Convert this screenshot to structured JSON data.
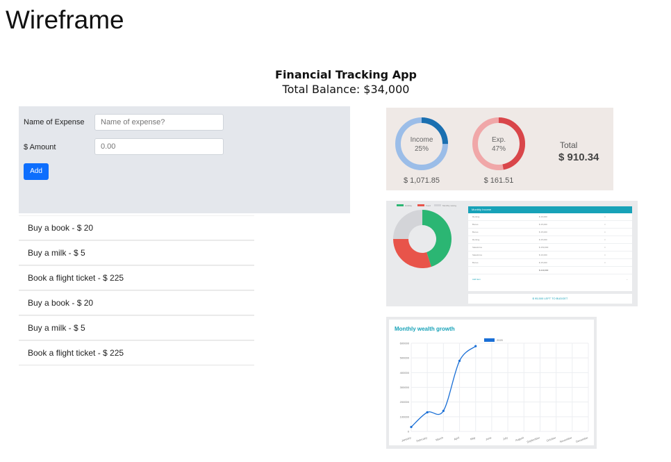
{
  "wireframe_title": "Wireframe",
  "app": {
    "title": "Financial Tracking App",
    "balance": "Total Balance: $34,000"
  },
  "form": {
    "name_label": "Name of Expense",
    "name_placeholder": "Name of expense?",
    "amount_label": "$ Amount",
    "amount_placeholder": "0.00",
    "add_label": "Add"
  },
  "expenses": [
    "Buy a book - $ 20",
    "Buy a milk - $ 5",
    "Book a flight ticket - $ 225",
    "Buy a book - $ 20",
    "Buy a milk - $ 5",
    "Book a flight ticket - $ 225"
  ],
  "summary": {
    "income_label": "Income",
    "income_pct": "25%",
    "income_amount": "$ 1,071.85",
    "income_fraction": 0.25,
    "exp_label": "Exp.",
    "exp_pct": "47%",
    "exp_amount": "$ 161.51",
    "exp_fraction": 0.47,
    "total_label": "Total",
    "total_value": "$ 910.34",
    "colors": {
      "income": "#1a6fb0",
      "income_track": "#9bbde8",
      "exp": "#d9464a",
      "exp_track": "#f0a7a8"
    }
  },
  "monthly_income": {
    "legend": [
      "Holiday",
      "Food",
      "Monthly saving"
    ],
    "title": "Monthly Income",
    "rows": [
      {
        "name": "Renting",
        "value": "$ 10,000"
      },
      {
        "name": "Bonus",
        "value": "$ 15,000"
      },
      {
        "name": "Bonus",
        "value": "$ 15,000"
      },
      {
        "name": "Renting",
        "value": "$ 15,000"
      },
      {
        "name": "Salesforce",
        "value": "$ 150,000"
      },
      {
        "name": "Salesforce",
        "value": "$ 10,000"
      },
      {
        "name": "Bonus",
        "value": "$ 15,000"
      }
    ],
    "total": "$ 240,000",
    "add_item": "Add item",
    "left_to_budget": "$ 95,500 LEFT TO BUDGET",
    "pie": [
      {
        "name": "Holiday",
        "value": 45,
        "color": "#2bb673"
      },
      {
        "name": "Food",
        "value": 30,
        "color": "#e8544a"
      },
      {
        "name": "Monthly saving",
        "value": 25,
        "color": "#d3d4d8"
      }
    ]
  },
  "chart_data": {
    "type": "line",
    "title": "Monthly wealth growth",
    "legend": "2020",
    "color": "#1a6fd6",
    "categories": [
      "January",
      "February",
      "March",
      "April",
      "May",
      "June",
      "July",
      "August",
      "September",
      "October",
      "November",
      "December"
    ],
    "series": [
      {
        "name": "2020",
        "values": [
          30000,
          130000,
          140000,
          480000,
          580000
        ]
      }
    ],
    "ylim": [
      0,
      600000
    ],
    "yticks": [
      0,
      100000,
      200000,
      300000,
      400000,
      500000,
      600000
    ]
  }
}
